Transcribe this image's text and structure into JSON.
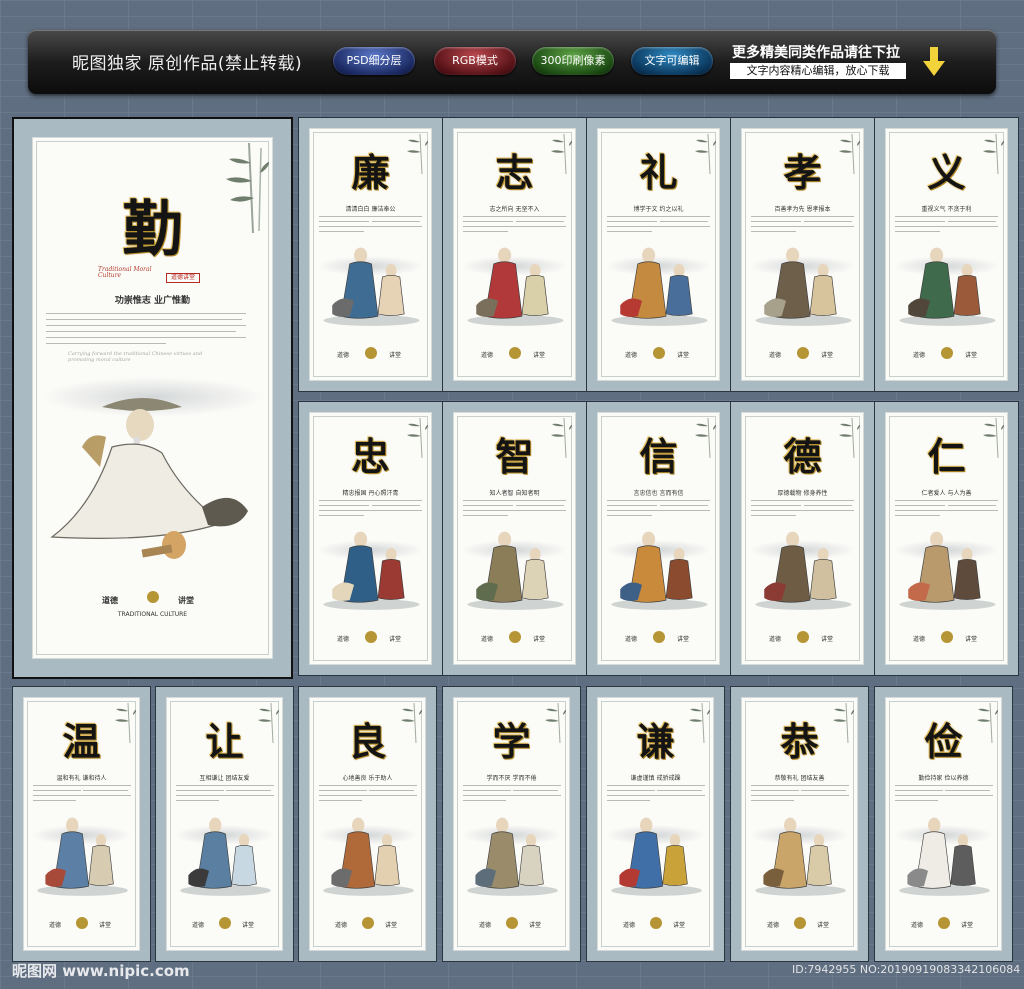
{
  "banner": {
    "title": "昵图独家 原创作品(禁止转载)",
    "badges": [
      "PSD细分层",
      "RGB模式",
      "300印刷像素",
      "文字可编辑"
    ],
    "more_text": "更多精美同类作品请往下拉",
    "more_sub": "文字内容精心编辑，放心下载",
    "arrow_icon": "down-arrow-icon"
  },
  "feature": {
    "char": "勤",
    "english_title": "Traditional Moral Culture",
    "seal_text": "道德讲堂",
    "slogan": "功崇惟志 业广惟勤",
    "tag_english": "Carrying forward the traditional Chinese virtues and promoting moral culture",
    "bottom_cn_left": "道德",
    "bottom_cn_right": "讲堂",
    "bottom_english": "TRADITIONAL CULTURE"
  },
  "posters": [
    {
      "char": "廉",
      "slogan": "清清白白 廉洁奉公"
    },
    {
      "char": "志",
      "slogan": "志之所向 无坚不入"
    },
    {
      "char": "礼",
      "slogan": "博学于文 约之以礼"
    },
    {
      "char": "孝",
      "slogan": "百善孝为先 恩孝报本"
    },
    {
      "char": "义",
      "slogan": "重视义气 不贪于利"
    },
    {
      "char": "忠",
      "slogan": "精忠报国 丹心照汗青"
    },
    {
      "char": "智",
      "slogan": "知人者智 自知者明"
    },
    {
      "char": "信",
      "slogan": "言忠信也 言而有信"
    },
    {
      "char": "德",
      "slogan": "厚德载物 修身养性"
    },
    {
      "char": "仁",
      "slogan": "仁者爱人 与人为善"
    },
    {
      "char": "温",
      "slogan": "温和有礼 谦和待人"
    },
    {
      "char": "让",
      "slogan": "互相谦让 团结友爱"
    },
    {
      "char": "良",
      "slogan": "心地善良 乐于助人"
    },
    {
      "char": "学",
      "slogan": "学而不厌 学而不倦"
    },
    {
      "char": "谦",
      "slogan": "谦虚谨慎 戒骄戒躁"
    },
    {
      "char": "恭",
      "slogan": "恭敬有礼 团结友善"
    },
    {
      "char": "俭",
      "slogan": "勤俭持家 俭以养德"
    }
  ],
  "poster_footer": {
    "left": "道德",
    "right": "讲堂"
  },
  "watermark": {
    "left": "昵图网 www.nipic.com",
    "right": "ID:7942955 NO:20190919083342106084"
  },
  "colors": {
    "background": "#5f6e80",
    "panel_mat": "#a9bac2",
    "char_gold": "#c9a23a",
    "seal_red": "#b52a25"
  }
}
